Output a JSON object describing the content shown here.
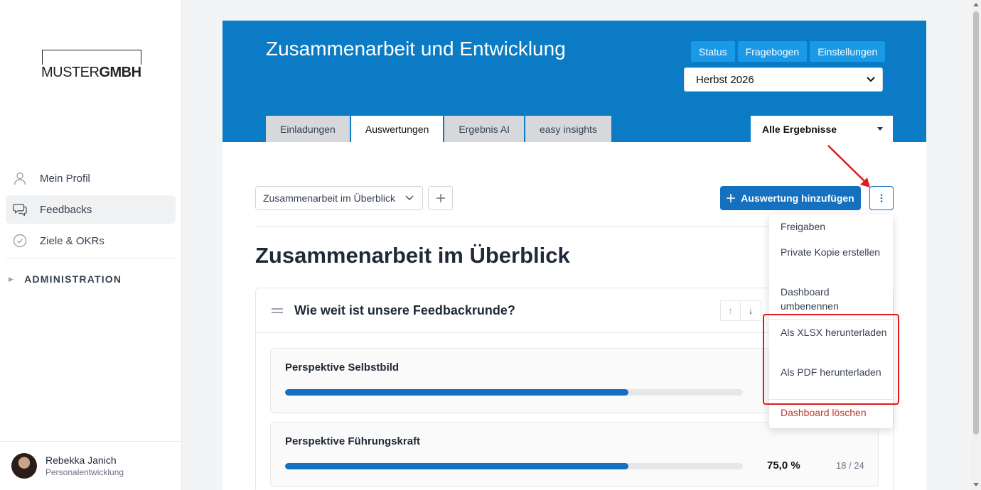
{
  "sidebar": {
    "logo_light": "MUSTER",
    "logo_bold": "GMBH",
    "items": [
      {
        "label": "Mein Profil",
        "icon": "user-icon"
      },
      {
        "label": "Feedbacks",
        "icon": "chat-bubbles-icon"
      },
      {
        "label": "Ziele & OKRs",
        "icon": "check-circle-icon"
      }
    ],
    "admin_label": "ADMINISTRATION",
    "user": {
      "name": "Rebekka Janich",
      "role": "Personalentwicklung"
    }
  },
  "header": {
    "title": "Zusammenarbeit und Entwicklung",
    "buttons": [
      "Status",
      "Fragebogen",
      "Einstellungen"
    ],
    "season": "Herbst 2026",
    "tabs": [
      "Einladungen",
      "Auswertungen",
      "Ergebnis AI",
      "easy insights"
    ],
    "active_tab": "Auswertungen",
    "results_filter": "Alle Ergebnisse"
  },
  "toolbar": {
    "dashboard_select": "Zusammenarbeit im Überblick",
    "add_label": "Auswertung hinzufügen"
  },
  "main": {
    "page_title": "Zusammenarbeit im Überblick",
    "card_title": "Wie weit ist unsere Feedbackrunde?",
    "stats": [
      {
        "label": "Perspektive Selbstbild",
        "progress": 75,
        "percent": "",
        "count": ""
      },
      {
        "label": "Perspektive Führungskraft",
        "progress": 75,
        "percent": "75,0 %",
        "count": "18 / 24"
      }
    ]
  },
  "menu": {
    "items": [
      "Freigaben",
      "Private Kopie erstellen",
      "Dashboard umbenennen",
      "Als XLSX herunterladen",
      "Als PDF herunterladen",
      "Dashboard löschen"
    ]
  },
  "colors": {
    "brand": "#0a7bc4",
    "primary": "#1570c0",
    "highlight": "#e01b1b",
    "danger": "#c0392b"
  }
}
